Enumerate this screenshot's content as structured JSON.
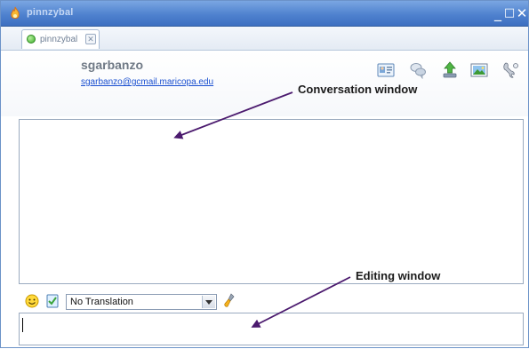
{
  "window": {
    "title": "pinnzybal",
    "controls": {
      "minimize": "_",
      "maximize": "□",
      "close": "✕"
    }
  },
  "tabs": [
    {
      "label": "pinnzybal",
      "status_color": "#3cae2a",
      "close": "✕"
    }
  ],
  "contact": {
    "name": "sgarbanzo",
    "email": "sgarbanzo@gcmail.maricopa.edu"
  },
  "toolbar_icons": [
    "contact-card-icon",
    "chat-bubbles-icon",
    "send-file-icon",
    "image-icon",
    "settings-icon"
  ],
  "edit_toolbar": {
    "emoticon_icon": "smiley-icon",
    "notes_icon": "notes-icon",
    "translation_value": "No Translation",
    "clear_icon": "brush-icon"
  },
  "annotations": {
    "conversation": "Conversation window",
    "editing": "Editing window"
  },
  "colors": {
    "title_bar": "#4f82cf",
    "link": "#1a4fd0",
    "annotation_arrow": "#4b1a6e"
  }
}
